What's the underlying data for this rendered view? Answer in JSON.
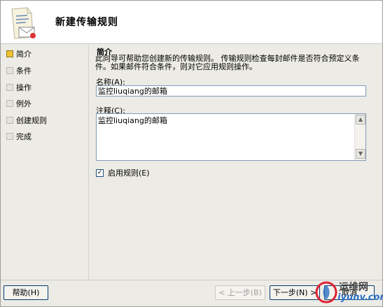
{
  "header": {
    "title": "新建传输规则",
    "icon": "mail-rule-icon"
  },
  "sidebar": {
    "items": [
      {
        "label": "简介",
        "active": true
      },
      {
        "label": "条件",
        "active": false
      },
      {
        "label": "操作",
        "active": false
      },
      {
        "label": "例外",
        "active": false
      },
      {
        "label": "创建规则",
        "active": false
      },
      {
        "label": "完成",
        "active": false
      }
    ]
  },
  "content": {
    "section_title": "简介",
    "description": "此向导可帮助您创建新的传输规则。 传输规则检查每封邮件是否符合预定义条件。如果邮件符合条件，则对它应用规则操作。",
    "name_label": "名称(A):",
    "name_value": "监控liuqiang的邮箱",
    "comment_label": "注释(C):",
    "comment_value": "监控liuqiang的邮箱",
    "enable_label": "启用规则(E)",
    "enable_checked": true
  },
  "footer": {
    "help_label": "帮助(H)",
    "back_label": "< 上一步(B)",
    "next_label": "下一步(N) >",
    "cancel_label": "取消"
  },
  "watermark": {
    "line1": "运维网",
    "line2": "iyunv.com"
  },
  "colors": {
    "active_step": "#f1c232",
    "input_border": "#7f9db9",
    "button_border": "#003c74",
    "watermark_blue": "#2a6fc4"
  }
}
